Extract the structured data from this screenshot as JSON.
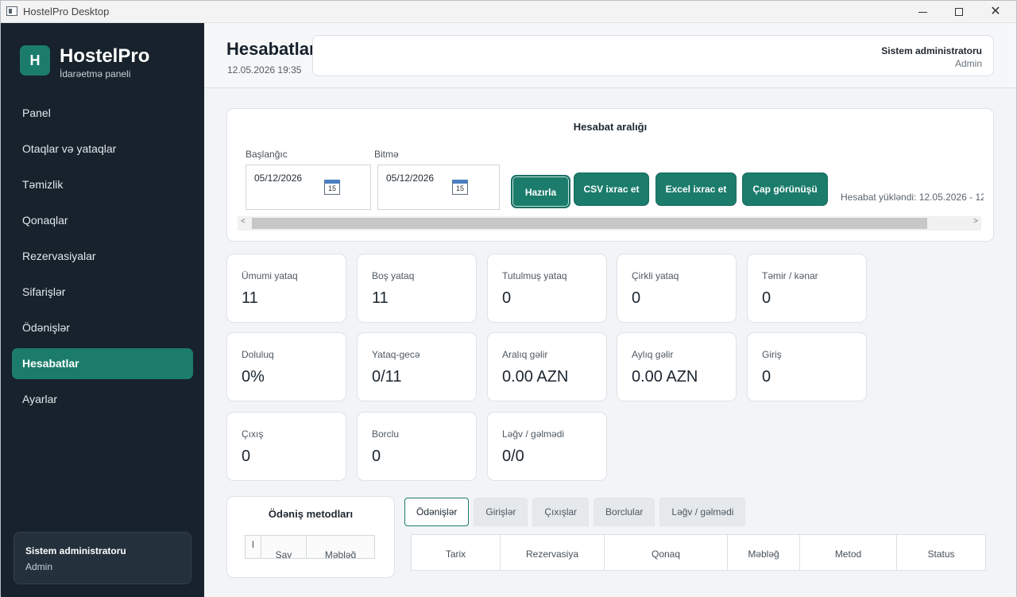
{
  "window": {
    "title": "HostelPro Desktop"
  },
  "sidebar": {
    "logo_letter": "H",
    "brand": "HostelPro",
    "subtitle": "İdarəetmə paneli",
    "items": [
      {
        "label": "Panel"
      },
      {
        "label": "Otaqlar və yataqlar"
      },
      {
        "label": "Təmizlik"
      },
      {
        "label": "Qonaqlar"
      },
      {
        "label": "Rezervasiyalar"
      },
      {
        "label": "Sifarişlər"
      },
      {
        "label": "Ödənişlər"
      },
      {
        "label": "Hesabatlar",
        "active": true
      },
      {
        "label": "Ayarlar"
      }
    ],
    "user": {
      "name": "Sistem administratoru",
      "role": "Admin"
    }
  },
  "header": {
    "title": "Hesabatlar",
    "datetime": "12.05.2026 19:35",
    "user": {
      "name": "Sistem administratoru",
      "role": "Admin"
    }
  },
  "range": {
    "title": "Hesabat aralığı",
    "start_label": "Başlanğıc",
    "start_value": "05/12/2026",
    "end_label": "Bitmə",
    "end_value": "05/12/2026",
    "calendar_day": "15",
    "buttons": {
      "prepare": "Hazırla",
      "csv": "CSV ixrac et",
      "excel": "Excel ixrac et",
      "print": "Çap görünüşü"
    },
    "loaded_text": "Hesabat yükləndi: 12.05.2026 - 12"
  },
  "stats": [
    {
      "label": "Ümumi yataq",
      "value": "11"
    },
    {
      "label": "Boş yataq",
      "value": "11"
    },
    {
      "label": "Tutulmuş yataq",
      "value": "0"
    },
    {
      "label": "Çirkli yataq",
      "value": "0"
    },
    {
      "label": "Təmir / kənar",
      "value": "0"
    },
    {
      "label": "Doluluq",
      "value": "0%"
    },
    {
      "label": "Yataq-gecə",
      "value": "0/11"
    },
    {
      "label": "Aralıq gəlir",
      "value": "0.00 AZN"
    },
    {
      "label": "Aylıq gəlir",
      "value": "0.00 AZN"
    },
    {
      "label": "Giriş",
      "value": "0"
    },
    {
      "label": "Çıxış",
      "value": "0"
    },
    {
      "label": "Borclu",
      "value": "0"
    },
    {
      "label": "Ləğv / gəlmədi",
      "value": "0/0"
    }
  ],
  "payment_methods": {
    "title": "Ödəniş metodları",
    "columns": [
      "I",
      "Say",
      "Məbləğ"
    ]
  },
  "tabs": [
    {
      "label": "Ödənişlər",
      "active": true
    },
    {
      "label": "Girişlər"
    },
    {
      "label": "Çıxışlar"
    },
    {
      "label": "Borclular"
    },
    {
      "label": "Ləğv / gəlmədi"
    }
  ],
  "table": {
    "columns": [
      "Tarix",
      "Rezervasiya",
      "Qonaq",
      "Məbləğ",
      "Metod",
      "Status"
    ]
  },
  "colors": {
    "accent": "#1b7c6b",
    "sidebar": "#17222c"
  }
}
